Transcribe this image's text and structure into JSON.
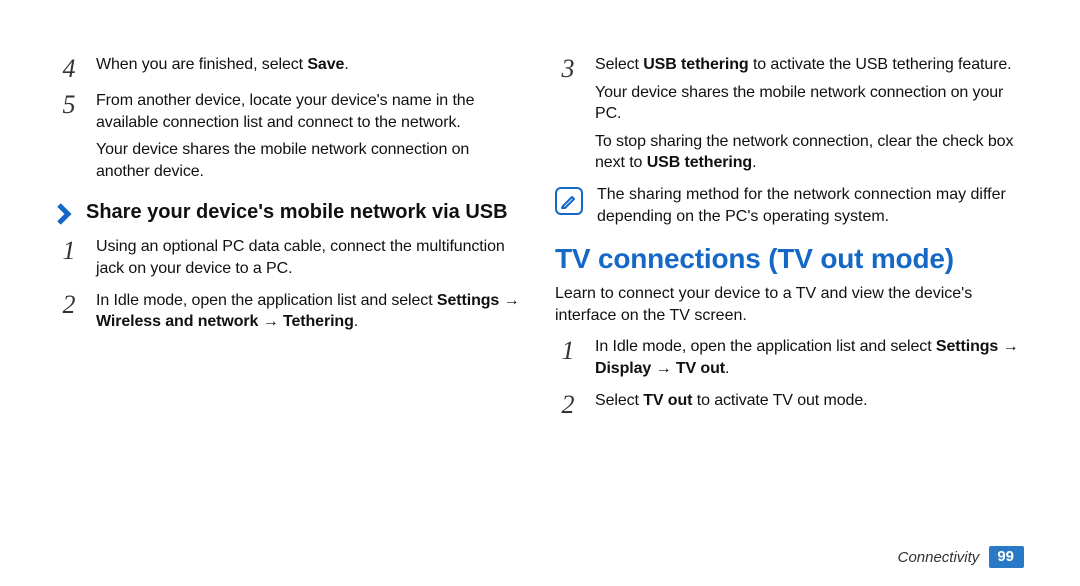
{
  "leftColumn": {
    "stepsA": [
      {
        "n": "4",
        "paras": [
          {
            "runs": [
              {
                "t": "When you are finished, select "
              },
              {
                "t": "Save",
                "b": true
              },
              {
                "t": "."
              }
            ]
          }
        ]
      },
      {
        "n": "5",
        "paras": [
          {
            "runs": [
              {
                "t": "From another device, locate your device's name in the available connection list and connect to the network."
              }
            ]
          },
          {
            "runs": [
              {
                "t": "Your device shares the mobile network connection on another device."
              }
            ]
          }
        ]
      }
    ],
    "subheading": "Share your device's mobile network via USB",
    "stepsB": [
      {
        "n": "1",
        "paras": [
          {
            "runs": [
              {
                "t": "Using an optional PC data cable, connect the multifunction jack on your device to a PC."
              }
            ]
          }
        ]
      },
      {
        "n": "2",
        "paras": [
          {
            "runs": [
              {
                "t": "In Idle mode, open the application list and select "
              },
              {
                "t": "Settings",
                "b": true
              },
              {
                "t": " → "
              },
              {
                "t": "Wireless and network",
                "b": true
              },
              {
                "t": " → "
              },
              {
                "t": "Tethering",
                "b": true
              },
              {
                "t": "."
              }
            ]
          }
        ]
      }
    ]
  },
  "rightColumn": {
    "stepsC": [
      {
        "n": "3",
        "paras": [
          {
            "runs": [
              {
                "t": "Select "
              },
              {
                "t": "USB tethering",
                "b": true
              },
              {
                "t": " to activate the USB tethering feature."
              }
            ]
          },
          {
            "runs": [
              {
                "t": "Your device shares the mobile network connection on your PC."
              }
            ]
          },
          {
            "runs": [
              {
                "t": "To stop sharing the network connection, clear the check box next to "
              },
              {
                "t": "USB tethering",
                "b": true
              },
              {
                "t": "."
              }
            ]
          }
        ]
      }
    ],
    "note": "The sharing method for the network connection may differ depending on the PC's operating system.",
    "sectionTitle": "TV connections (TV out mode)",
    "sectionIntro": "Learn to connect your device to a TV and view the device's interface on the TV screen.",
    "stepsD": [
      {
        "n": "1",
        "paras": [
          {
            "runs": [
              {
                "t": "In Idle mode, open the application list and select "
              },
              {
                "t": "Settings",
                "b": true
              },
              {
                "t": " → "
              },
              {
                "t": "Display",
                "b": true
              },
              {
                "t": " → "
              },
              {
                "t": "TV out",
                "b": true
              },
              {
                "t": "."
              }
            ]
          }
        ]
      },
      {
        "n": "2",
        "paras": [
          {
            "runs": [
              {
                "t": "Select "
              },
              {
                "t": "TV out",
                "b": true
              },
              {
                "t": " to activate TV out mode."
              }
            ]
          }
        ]
      }
    ]
  },
  "footer": {
    "category": "Connectivity",
    "page": "99"
  }
}
